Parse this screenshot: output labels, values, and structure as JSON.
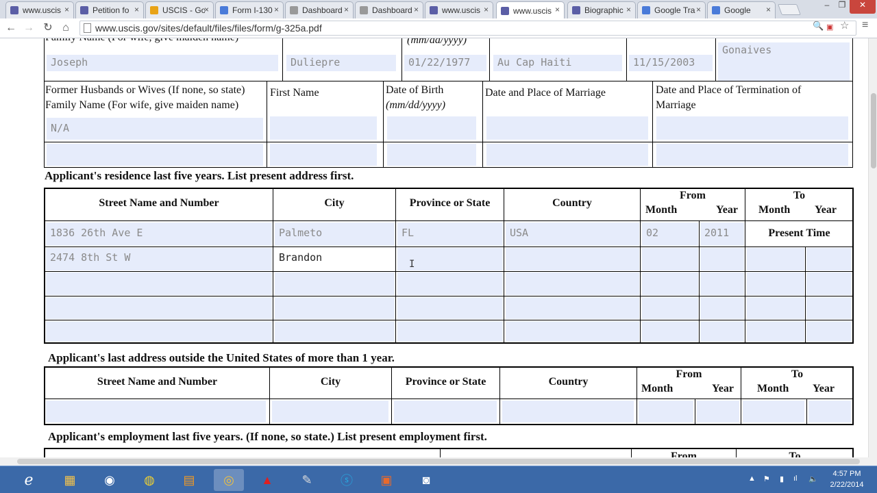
{
  "browser": {
    "tabs": [
      {
        "label": "www.uscis",
        "icon": "seal-icon",
        "color": "#5b5ea6",
        "active": false
      },
      {
        "label": "Petition fo",
        "icon": "seal-icon",
        "color": "#5b5ea6",
        "active": false
      },
      {
        "label": "USCIS - Go",
        "icon": "drive-icon",
        "color": "#e8a317",
        "active": false
      },
      {
        "label": "Form I-130",
        "icon": "form-icon",
        "color": "#4a7bd9",
        "active": false
      },
      {
        "label": "Dashboard",
        "icon": "page-icon",
        "color": "#999999",
        "active": false
      },
      {
        "label": "Dashboard",
        "icon": "page-icon",
        "color": "#999999",
        "active": false
      },
      {
        "label": "www.uscis",
        "icon": "seal-icon",
        "color": "#5b5ea6",
        "active": false
      },
      {
        "label": "www.uscis",
        "icon": "seal-icon",
        "color": "#5b5ea6",
        "active": true
      },
      {
        "label": "Biographic",
        "icon": "seal-icon",
        "color": "#5b5ea6",
        "active": false
      },
      {
        "label": "Google Tra",
        "icon": "translate-icon",
        "color": "#4a7bd9",
        "active": false
      },
      {
        "label": "Google",
        "icon": "google-icon",
        "color": "#4a7bd9",
        "active": false
      }
    ],
    "url": "www.uscis.gov/sites/default/files/files/form/g-325a.pdf"
  },
  "form": {
    "top_row": {
      "partial_label_left": "Family Name (For wife, give maiden name)",
      "partial_label_dob": "(mm/dd/yyyy)",
      "family_name": "Joseph",
      "first_name": "Duliepre",
      "dob": "01/22/1977",
      "place_of_marriage": "Au Cap Haiti",
      "date_of_marriage": "11/15/2003",
      "place_termination": "Gonaives"
    },
    "former_spouses": {
      "col1": "Former Husbands or Wives (If none, so state)",
      "col1b": "Family Name (For wife, give maiden name)",
      "col2": "First Name",
      "col3": "Date of Birth",
      "col3b": "(mm/dd/yyyy)",
      "col4": "Date and Place of Marriage",
      "col5": "Date and Place of Termination of",
      "col5b": "Marriage",
      "value1": "N/A"
    },
    "residence": {
      "title": "Applicant's residence last five years.  List present address first.",
      "headers": {
        "street": "Street Name and Number",
        "city": "City",
        "province": "Province or State",
        "country": "Country",
        "from": "From",
        "to": "To",
        "month": "Month",
        "year": "Year"
      },
      "row1": {
        "street": "1836 26th Ave E",
        "city": "Palmeto",
        "province": "FL",
        "country": "USA",
        "month": "02",
        "year": "2011",
        "to": "Present Time"
      },
      "row2": {
        "street": "2474  8th St W",
        "city": "Brandon"
      }
    },
    "outside_us": {
      "title": "Applicant's last address outside the United States of more than 1 year."
    },
    "employment": {
      "title": "Applicant's employment last five years.  (If none, so state.) List present employment first.",
      "from": "From",
      "to": "To"
    }
  },
  "taskbar": {
    "time": "4:57 PM",
    "date": "2/22/2014"
  }
}
